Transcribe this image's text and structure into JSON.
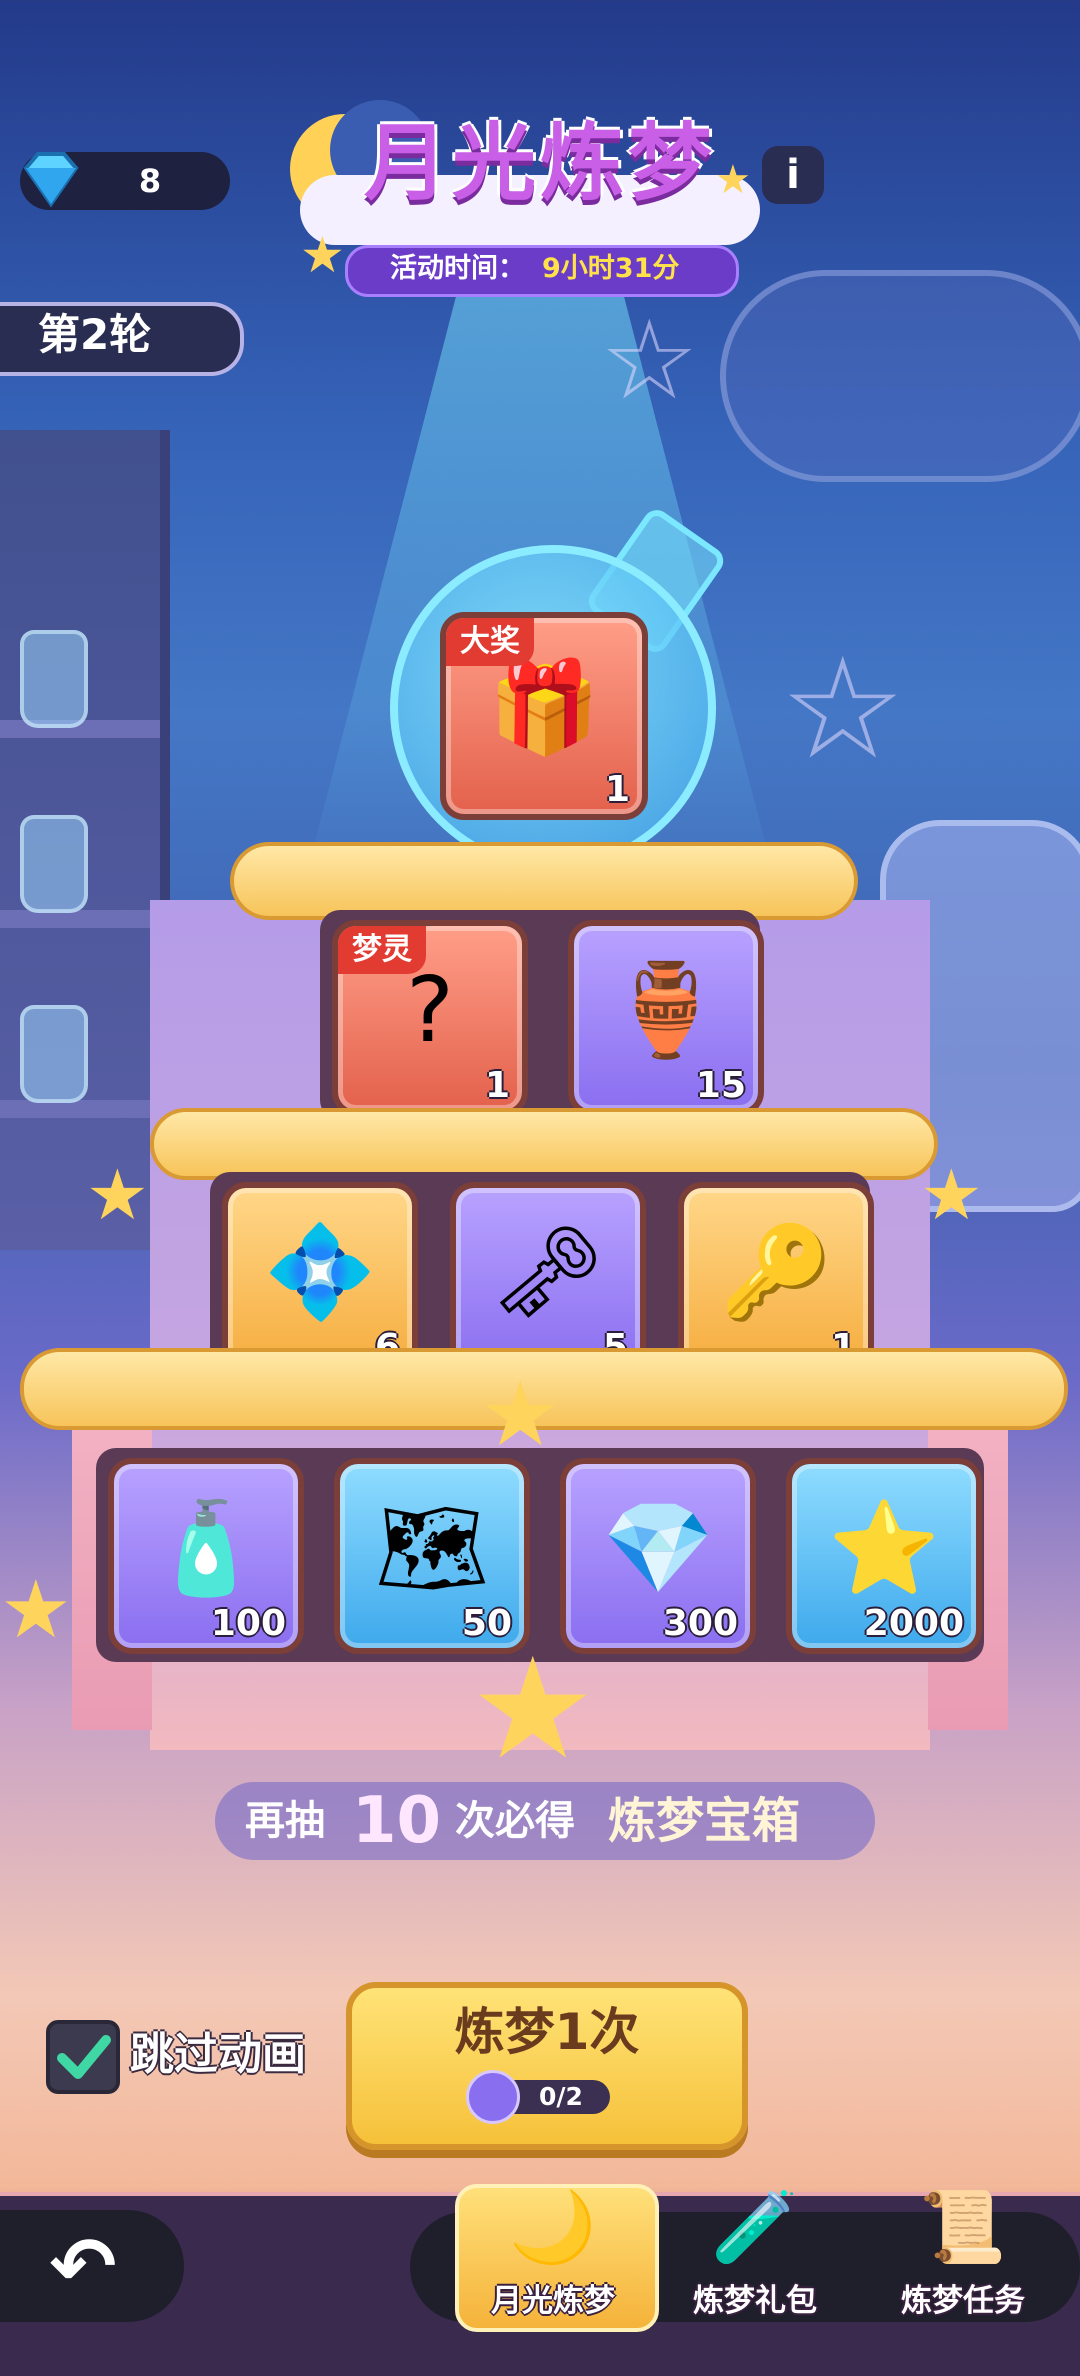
{
  "header": {
    "gems": "8",
    "title": "月光炼梦",
    "time_label": "活动时间：",
    "time_value": "9小时31分",
    "info": "i",
    "round": "第2轮"
  },
  "grand_prize": {
    "badge": "大奖",
    "qty": "1",
    "icon": "treasure-chest-icon"
  },
  "tier2": [
    {
      "badge": "梦灵",
      "qty": "1",
      "icon": "mystery-box-icon",
      "glyph": "?",
      "color": "red"
    },
    {
      "qty": "15",
      "icon": "spirit-pot-icon",
      "glyph": "🏺",
      "color": "purple"
    }
  ],
  "tier3": [
    {
      "qty": "6",
      "icon": "crystal-cube-icon",
      "glyph": "💠",
      "color": "gold"
    },
    {
      "qty": "5",
      "icon": "purple-key-icon",
      "glyph": "🗝",
      "color": "purple"
    },
    {
      "qty": "1",
      "icon": "star-key-icon",
      "glyph": "🔑",
      "color": "gold"
    }
  ],
  "tier4": [
    {
      "qty": "100",
      "icon": "rainbow-bottle-icon",
      "glyph": "🧴",
      "color": "purple"
    },
    {
      "qty": "50",
      "icon": "map-icon",
      "glyph": "🗺",
      "color": "blue"
    },
    {
      "qty": "300",
      "icon": "green-crystal-icon",
      "glyph": "💎",
      "color": "purple"
    },
    {
      "qty": "2000",
      "icon": "gold-coin-icon",
      "glyph": "⭐",
      "color": "blue"
    }
  ],
  "guarantee": {
    "pre": "再抽",
    "num": "10",
    "mid": "次必得",
    "item": "炼梦宝箱"
  },
  "controls": {
    "skip_label": "跳过动画",
    "skip_checked": true,
    "draw_label": "炼梦1次",
    "draw_cost": "0/2"
  },
  "nav": {
    "tabs": [
      {
        "label": "月光炼梦",
        "icon": "moon-machine-icon",
        "active": true
      },
      {
        "label": "炼梦礼包",
        "icon": "potion-gift-icon",
        "active": false
      },
      {
        "label": "炼梦任务",
        "icon": "scroll-task-icon",
        "active": false
      }
    ]
  },
  "colors": {
    "accent": "#f6c13a",
    "title": "#c85fe6",
    "badge": "#e23b32",
    "time": "#ffe14a"
  }
}
